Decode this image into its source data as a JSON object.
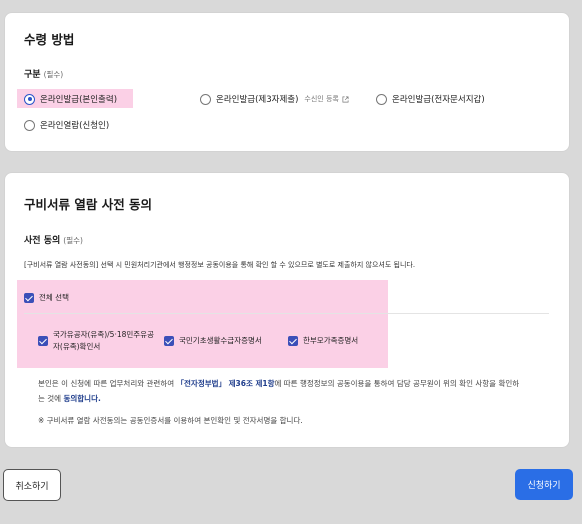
{
  "receipt": {
    "title": "수령 방법",
    "section_label": "구분",
    "required": "(필수)",
    "options": [
      {
        "label": "온라인발급(본인출력)",
        "selected": true
      },
      {
        "label": "온라인발급(제3자제출)",
        "selected": false,
        "note": "수신인 등록"
      },
      {
        "label": "온라인발급(전자문서지갑)",
        "selected": false
      },
      {
        "label": "온라인열람(신청인)",
        "selected": false
      }
    ]
  },
  "consent": {
    "title": "구비서류 열람 사전 동의",
    "section_label": "사전 동의",
    "required": "(필수)",
    "description": "[구비서류 열람 사전동의] 선택 시 민원처리기관에서 행정정보 공동이용을 통해 확인 할 수 있으므로 별도로 제출하지 않으셔도 됩니다.",
    "select_all": "전체 선택",
    "items": [
      {
        "line1": "국가유공자(유족)/5·18민주유공",
        "line2": "자(유족)확인서"
      },
      {
        "label": "국민기초생활수급자증명서"
      },
      {
        "label": "한부모가족증명서"
      }
    ],
    "notice1_a": "본인은 이 신청에 따른 업무처리와 관련하여 ",
    "notice1_b": "「전자정부법」 제36조 제1항",
    "notice1_c": "에 따른 행정정보의 공동이용을 통하여 담당 공무원이 위의 확인 사항을 확인하",
    "notice1_d": "는 것에 ",
    "notice1_e": "동의합니다.",
    "notice2": "※ 구비서류 열람 사전동의는 공동인증서를 이용하여 본인확인 및 전자서명을 합니다."
  },
  "buttons": {
    "cancel": "취소하기",
    "apply": "신청하기"
  },
  "colors": {
    "accent": "#2a6ee6",
    "highlight": "#fbd0e6",
    "checkbox": "#3b4fb8"
  }
}
